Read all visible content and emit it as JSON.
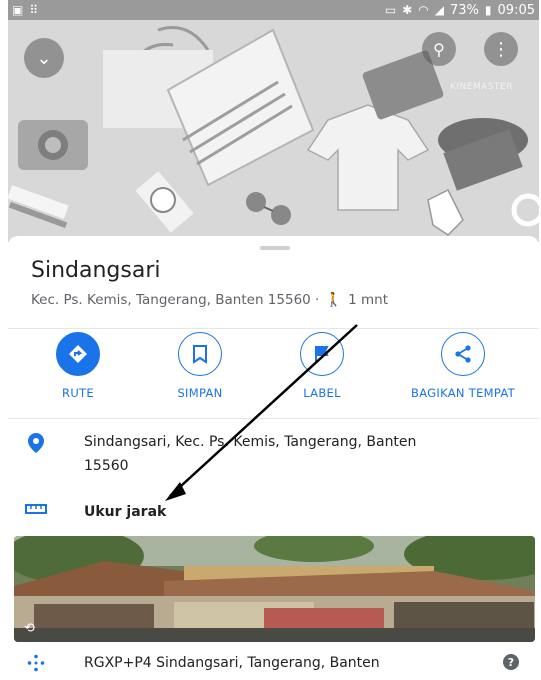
{
  "status_bar": {
    "battery": "73%",
    "time": "09:05"
  },
  "hero": {
    "watermark": "KINEMASTER"
  },
  "place": {
    "title": "Sindangsari",
    "subtitle": "Kec. Ps. Kemis, Tangerang, Banten 15560 ·",
    "walk_time": "1 mnt"
  },
  "actions": [
    {
      "label": "RUTE",
      "icon": "directions-icon"
    },
    {
      "label": "SIMPAN",
      "icon": "bookmark-icon"
    },
    {
      "label": "LABEL",
      "icon": "flag-icon"
    },
    {
      "label": "BAGIKAN TEMPAT",
      "icon": "share-icon"
    }
  ],
  "details": {
    "address": "Sindangsari, Kec. Ps. Kemis, Tangerang, Banten",
    "address_line2": "15560",
    "measure": "Ukur jarak",
    "plus_code": "RGXP+P4 Sindangsari, Tangerang, Banten"
  },
  "colors": {
    "accent": "#1a73e8",
    "status_bar": "#9a9a9a"
  }
}
